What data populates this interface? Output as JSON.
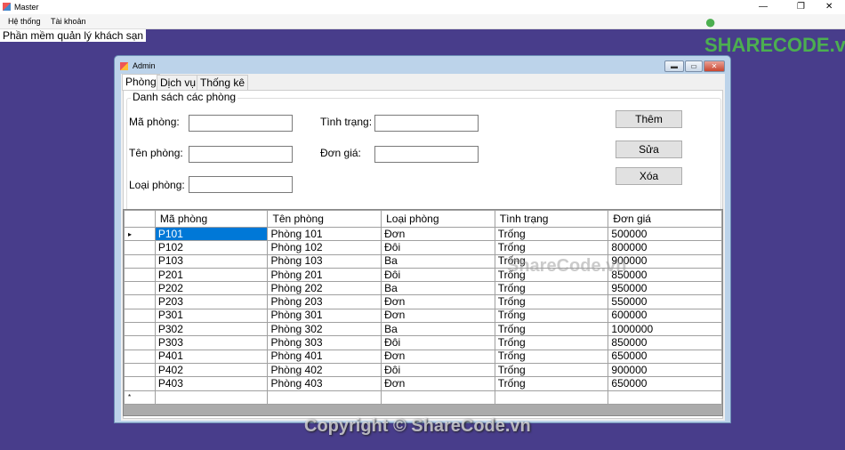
{
  "window": {
    "title": "Master",
    "min": "—",
    "max": "❐",
    "close": "✕"
  },
  "menu": [
    "Hệ thống",
    "Tài khoản"
  ],
  "app_title": "Phần mềm quản lý khách sạn",
  "admin": {
    "title": "Admin",
    "min": "▬",
    "max": "▭",
    "close": "✕",
    "tabs": [
      "Phòng",
      "Dịch vụ",
      "Thống kê"
    ],
    "group_title": "Danh sách các phòng",
    "fields": {
      "ma_phong": {
        "label": "Mã phòng:",
        "value": ""
      },
      "ten_phong": {
        "label": "Tên phòng:",
        "value": ""
      },
      "loai_phong": {
        "label": "Loại phòng:",
        "value": ""
      },
      "tinh_trang": {
        "label": "Tình trạng:",
        "value": ""
      },
      "don_gia": {
        "label": "Đơn giá:",
        "value": ""
      }
    },
    "buttons": {
      "them": "Thêm",
      "sua": "Sửa",
      "xoa": "Xóa"
    },
    "grid": {
      "columns": [
        "Mã phòng",
        "Tên phòng",
        "Loại phòng",
        "Tình trạng",
        "Đơn giá"
      ],
      "current_marker": "▸",
      "new_row_marker": "*",
      "rows": [
        [
          "P101",
          "Phòng 101",
          "Đơn",
          "Trống",
          "500000"
        ],
        [
          "P102",
          "Phòng 102",
          "Đôi",
          "Trống",
          "800000"
        ],
        [
          "P103",
          "Phòng 103",
          "Ba",
          "Trống",
          "900000"
        ],
        [
          "P201",
          "Phòng 201",
          "Đôi",
          "Trống",
          "850000"
        ],
        [
          "P202",
          "Phòng 202",
          "Ba",
          "Trống",
          "950000"
        ],
        [
          "P203",
          "Phòng 203",
          "Đơn",
          "Trống",
          "550000"
        ],
        [
          "P301",
          "Phòng 301",
          "Đơn",
          "Trống",
          "600000"
        ],
        [
          "P302",
          "Phòng 302",
          "Ba",
          "Trống",
          "1000000"
        ],
        [
          "P303",
          "Phòng 303",
          "Đôi",
          "Trống",
          "850000"
        ],
        [
          "P401",
          "Phòng 401",
          "Đơn",
          "Trống",
          "650000"
        ],
        [
          "P402",
          "Phòng 402",
          "Đôi",
          "Trống",
          "900000"
        ],
        [
          "P403",
          "Phòng 403",
          "Đơn",
          "Trống",
          "650000"
        ]
      ]
    }
  },
  "watermark": {
    "logo": "SHARECODE.vn",
    "center": "ShareCode.vn",
    "bottom": "Copyright © ShareCode.vn"
  },
  "colors": {
    "desktop": "#483d8b",
    "selection": "#0078d7"
  }
}
